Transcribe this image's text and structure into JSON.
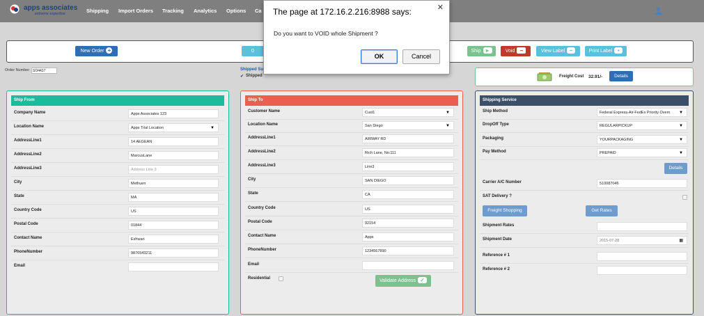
{
  "brand": {
    "name": "apps associates",
    "tagline": "extreme expertise"
  },
  "nav": [
    "Shipping",
    "Import Orders",
    "Tracking",
    "Analytics",
    "Options",
    "Ca"
  ],
  "colors": {
    "topbar": "#7f7f7f",
    "ship_from": "#1abc9c",
    "ship_to": "#e9604f",
    "shipping_service": "#3b5068",
    "primary_btn": "#2f6db5",
    "void_btn": "#c0392b",
    "info_btn": "#5bc0de",
    "success_btn": "#7ac38e",
    "steel_btn": "#6e9ccc"
  },
  "actions": {
    "new_order": "New Order",
    "partial_hidden": "0",
    "ship": "Ship",
    "void": "Void",
    "view_label": "View Label",
    "print_label": "Print Label"
  },
  "order": {
    "label": "Order Number",
    "value": "SO4437"
  },
  "shipped": {
    "status_label": "Shipped Su",
    "checkbox_label": "Shipped"
  },
  "freight": {
    "label": "Freight Cost",
    "value": "32.91/-",
    "details": "Details"
  },
  "ship_from": {
    "title": "Ship From",
    "company_name": {
      "label": "Company Name",
      "value": "Apps Associates 123"
    },
    "location_name": {
      "label": "Location Name",
      "value": "Apps Trial Location"
    },
    "address1": {
      "label": "AddressLine1",
      "value": "14 AEGEAN"
    },
    "address2": {
      "label": "AddressLine2",
      "value": "MarcusLane"
    },
    "address3": {
      "label": "AddressLine3",
      "placeholder": "Address Line 3"
    },
    "city": {
      "label": "City",
      "value": "Methuen"
    },
    "state": {
      "label": "State",
      "value": "MA"
    },
    "country": {
      "label": "Country Code",
      "value": "US"
    },
    "postal": {
      "label": "Postal Code",
      "value": "01844"
    },
    "contact": {
      "label": "Contact Name",
      "value": "Eshwari"
    },
    "phone": {
      "label": "PhoneNumber",
      "value": "9876543211"
    },
    "email": {
      "label": "Email",
      "value": ""
    }
  },
  "ship_to": {
    "title": "Ship To",
    "customer_name": {
      "label": "Customer Name",
      "value": "Cust1"
    },
    "location_name": {
      "label": "Location Name",
      "value": "San Diego"
    },
    "address1": {
      "label": "AddressLine1",
      "value": "AIRWAY RD"
    },
    "address2": {
      "label": "AddressLine2",
      "value": "Rich Lane, No:111"
    },
    "address3": {
      "label": "AddressLine3",
      "value": "Line3"
    },
    "city": {
      "label": "City",
      "value": "SAN DIEGO"
    },
    "state": {
      "label": "State",
      "value": "CA"
    },
    "country": {
      "label": "Country Code",
      "value": "US"
    },
    "postal": {
      "label": "Postal Code",
      "value": "92154"
    },
    "contact": {
      "label": "Contact Name",
      "value": "Apps"
    },
    "phone": {
      "label": "PhoneNumber",
      "value": "1234567890"
    },
    "email": {
      "label": "Email",
      "value": ""
    },
    "residential": {
      "label": "Residential"
    },
    "validate": "Validate Address"
  },
  "shipping_service": {
    "title": "Shipping Service",
    "ship_method": {
      "label": "Ship Method",
      "value": "Federal Express-Air-FedEx Priority Overn"
    },
    "dropoff": {
      "label": "DropOff Type",
      "value": "REGULARPICKUP"
    },
    "packaging": {
      "label": "Packaging",
      "value": "YOURPACKAGING"
    },
    "pay_method": {
      "label": "Pay Method",
      "value": "PREPAID"
    },
    "details": "Details",
    "carrier_ac": {
      "label": "Carrier A/C Number",
      "value": "510087046"
    },
    "sat_delivery": {
      "label": "SAT Delivery ?"
    },
    "freight_shopping": "Freight Shopping",
    "get_rates": "Get Rates",
    "shipment_rates": {
      "label": "Shipment Rates",
      "value": ""
    },
    "shipment_date": {
      "label": "Shipment Date",
      "value": "2015-07-28"
    },
    "reference1": {
      "label": "Reference # 1",
      "value": ""
    },
    "reference2": {
      "label": "Reference # 2",
      "value": ""
    }
  },
  "dialog": {
    "title": "The page at 172.16.2.216:8988 says:",
    "message": "Do you want to VOID whole Shipment ?",
    "ok": "OK",
    "cancel": "Cancel"
  }
}
